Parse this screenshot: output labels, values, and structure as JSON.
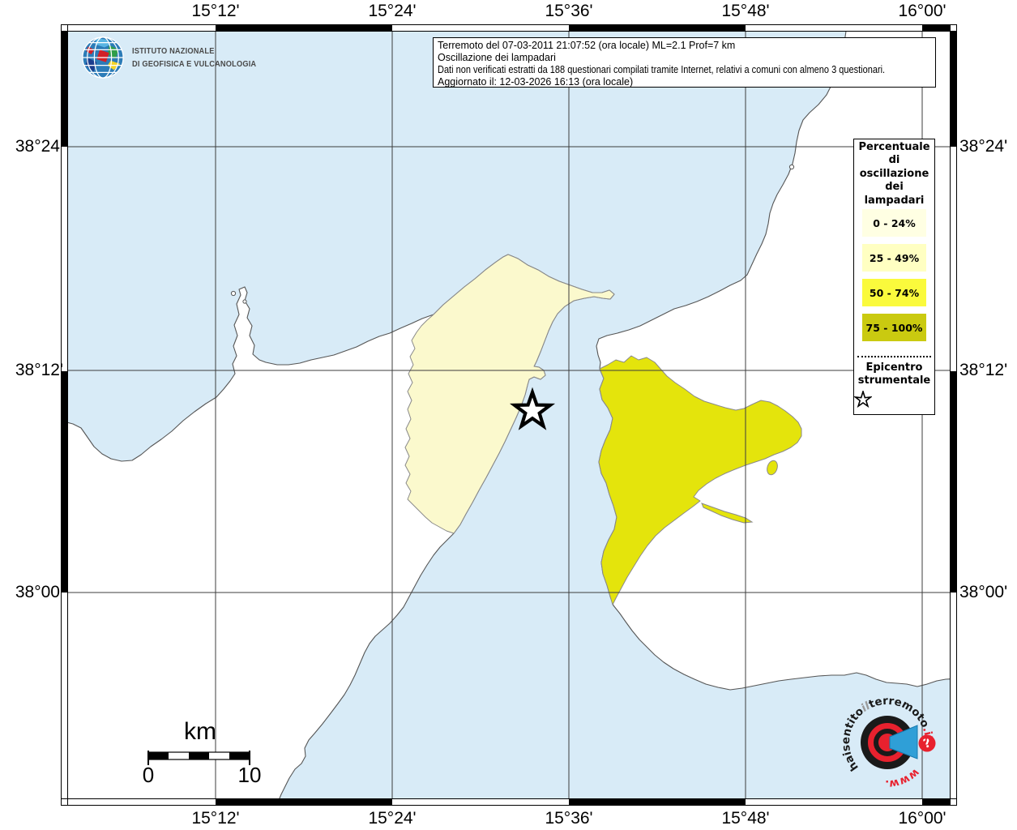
{
  "map": {
    "sea_color": "#D8EBF7",
    "land_color": "#FFFFFF",
    "coast_color": "#555555",
    "grid_color": "#3C3C3C",
    "region_low_color": "#FBF9CD",
    "region_high_color": "#E4E40C"
  },
  "axes": {
    "lon_labels": [
      "15°12'",
      "15°24'",
      "15°36'",
      "15°48'",
      "16°00'"
    ],
    "lat_labels": [
      "38°24'",
      "38°12'",
      "38°00'"
    ]
  },
  "info_box": {
    "lines": [
      "Terremoto del 07-03-2011 21:07:52 (ora locale) ML=2.1 Prof=7 km",
      "Oscillazione dei lampadari",
      "Dati non verificati estratti da 188 questionari compilati tramite Internet, relativi a comuni con almeno 3 questionari.",
      "Aggiornato il: 12-03-2026 16:13 (ora locale)"
    ]
  },
  "ingv_logo": {
    "icon": "ingv-globe",
    "line1": "ISTITUTO NAZIONALE",
    "line2": "DI GEOFISICA E VULCANOLOGIA"
  },
  "legend": {
    "title": "Percentuale di oscillazione dei lampadari",
    "classes": [
      {
        "label": "0 - 24%",
        "color": "#FFFFE3"
      },
      {
        "label": "25 - 49%",
        "color": "#FFFFC2"
      },
      {
        "label": "50 - 74%",
        "color": "#FAFA3C"
      },
      {
        "label": "75 - 100%",
        "color": "#CACA10"
      }
    ],
    "epicenter_label": "Epicentro strumentale",
    "epicenter_icon": "star-outline"
  },
  "scalebar": {
    "unit": "km",
    "start": "0",
    "end": "10"
  },
  "watermark": {
    "icon": "bullseye-megaphone",
    "pre": "haisentito",
    "mid": "il",
    "main": "terremoto",
    "tld": ".it",
    "www": "www.",
    "question": "?"
  }
}
